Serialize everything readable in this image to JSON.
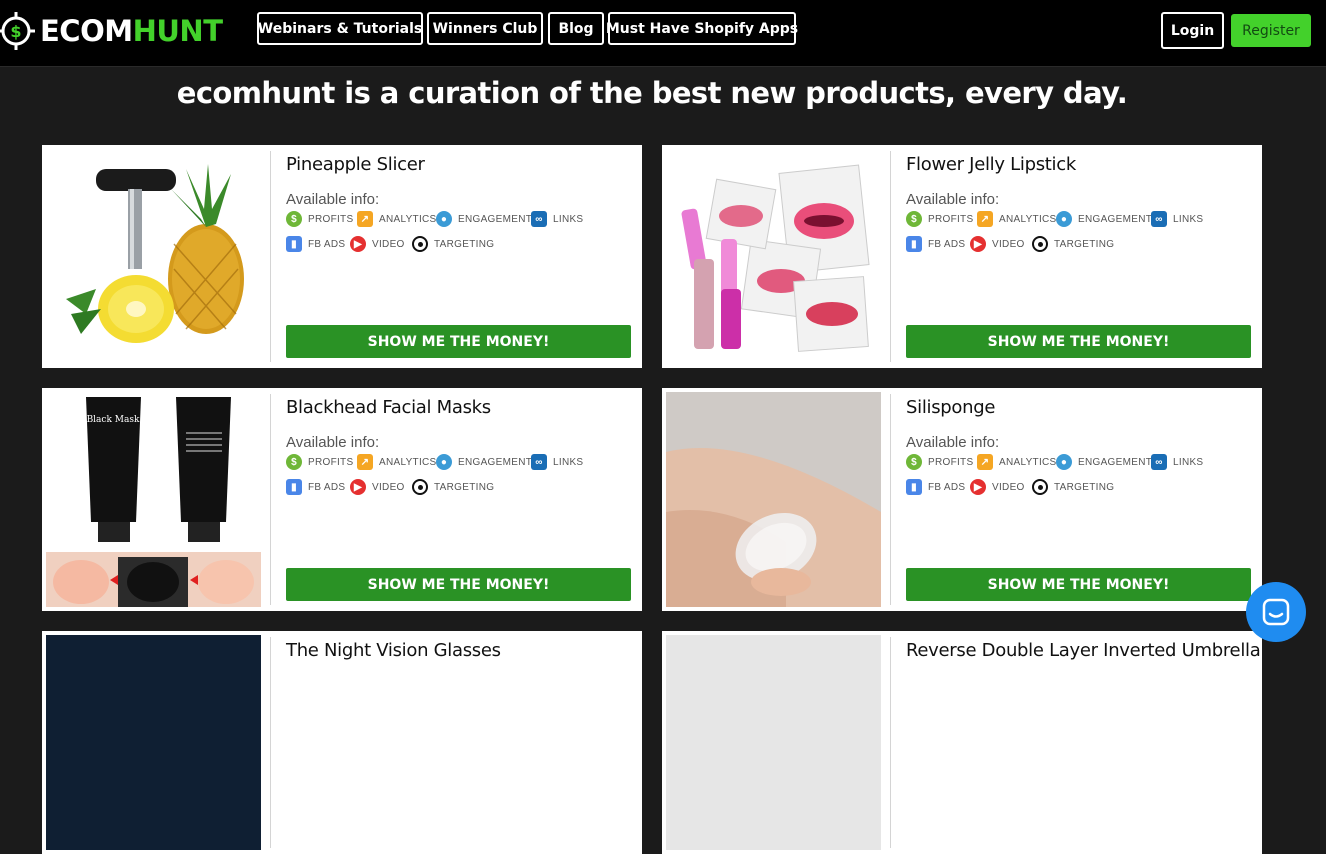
{
  "header": {
    "logo_part1": "ECOM",
    "logo_part2": "HUNT",
    "nav": [
      "Webinars & Tutorials",
      "Winners Club",
      "Blog",
      "Must Have Shopify Apps"
    ],
    "login_label": "Login",
    "register_label": "Register"
  },
  "headline": "ecomhunt is a curation of the best new products, every day.",
  "available_label": "Available info:",
  "features": [
    {
      "label": "PROFITS",
      "icon": "dollar-icon",
      "color": "#6fb738"
    },
    {
      "label": "ANALYTICS",
      "icon": "analytics-icon",
      "color": "#f5a623"
    },
    {
      "label": "ENGAGEMENT",
      "icon": "user-icon",
      "color": "#3b9bd6"
    },
    {
      "label": "LINKS",
      "icon": "link-icon",
      "color": "#1a6db5"
    },
    {
      "label": "FB ADS",
      "icon": "bar-chart-icon",
      "color": "#4a86e8"
    },
    {
      "label": "VIDEO",
      "icon": "play-icon",
      "color": "#e53030"
    },
    {
      "label": "TARGETING",
      "icon": "target-icon",
      "color": "#111111"
    }
  ],
  "cta_label": "SHOW ME THE MONEY!",
  "products": [
    {
      "title": "Pineapple Slicer"
    },
    {
      "title": "Flower Jelly Lipstick"
    },
    {
      "title": "Blackhead Facial Masks"
    },
    {
      "title": "Silisponge"
    },
    {
      "title": "The Night Vision Glasses"
    },
    {
      "title": "Reverse Double Layer Inverted Umbrella"
    }
  ],
  "colors": {
    "accent_green": "#43d12b",
    "cta_green": "#2a9225",
    "chat_blue": "#1f8cf0"
  }
}
